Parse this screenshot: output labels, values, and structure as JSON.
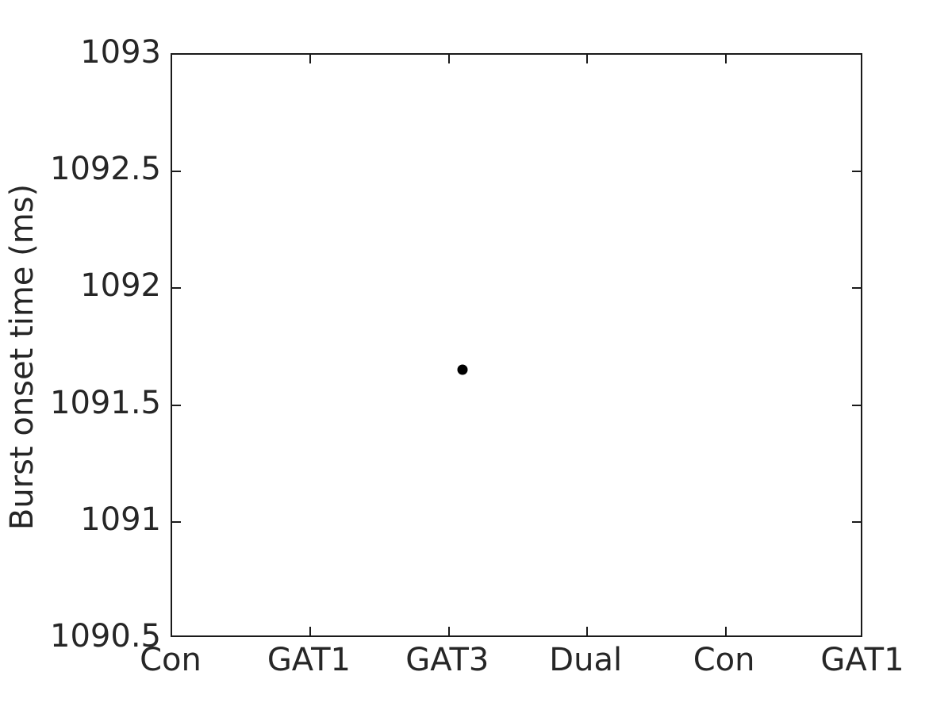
{
  "chart_data": {
    "type": "scatter",
    "title": "",
    "xlabel": "",
    "ylabel": "Burst onset time (ms)",
    "categories": [
      "Con",
      "GAT1",
      "GAT3",
      "Dual",
      "Con",
      "GAT1"
    ],
    "xtick_labels": [
      "Con",
      "GAT1",
      "GAT3",
      "Dual",
      "Con",
      "GAT1"
    ],
    "ytick_labels": [
      "1093",
      "1092.5",
      "1092",
      "1091.5",
      "1091",
      "1090.5"
    ],
    "ytick_values": [
      1093,
      1092.5,
      1092,
      1091.5,
      1091,
      1090.5
    ],
    "ylim": [
      1090.5,
      1093
    ],
    "xlim": [
      0.5,
      6.5
    ],
    "grid": false,
    "legend": false,
    "marker": "filled-circle",
    "marker_color": "#000000",
    "marker_size": 13,
    "points": [
      {
        "category": "GAT3",
        "x": 3.1,
        "y": 1091.65
      }
    ],
    "series": [
      {
        "name": "Burst onset time",
        "values": [
          null,
          null,
          1091.65,
          null,
          null,
          null
        ]
      }
    ]
  },
  "axes": {
    "frame_color": "#1a1a1a",
    "background": "#ffffff",
    "tick_direction": "in"
  }
}
